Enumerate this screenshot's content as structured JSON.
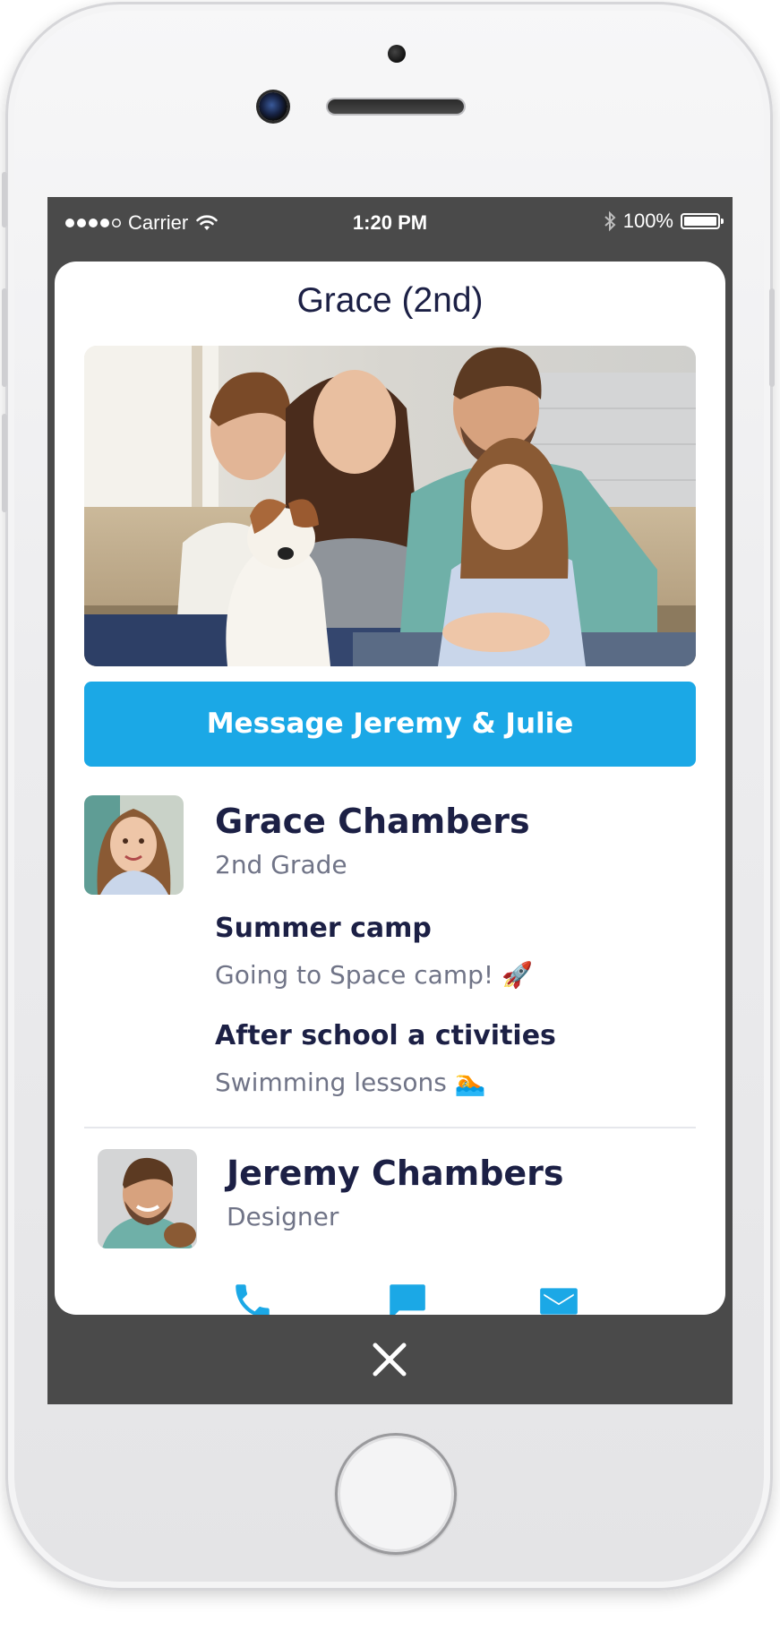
{
  "status_bar": {
    "carrier": "Carrier",
    "time": "1:20 PM",
    "battery": "100%"
  },
  "card": {
    "title": "Grace (2nd)",
    "message_button": "Message Jeremy & Julie"
  },
  "student": {
    "name": "Grace Chambers",
    "grade": "2nd Grade",
    "fields": [
      {
        "label": "Summer camp",
        "value": "Going to Space camp! 🚀"
      },
      {
        "label": "After school a ctivities",
        "value": "Swimming lessons 🏊"
      }
    ]
  },
  "parent": {
    "name": "Jeremy Chambers",
    "role": "Designer"
  },
  "actions": [
    "phone-icon",
    "chat-icon",
    "mail-icon"
  ],
  "colors": {
    "accent": "#1ba8e6",
    "navy_text": "#1c2045",
    "secondary_text": "#707487",
    "chrome": "#4a4a4a"
  }
}
